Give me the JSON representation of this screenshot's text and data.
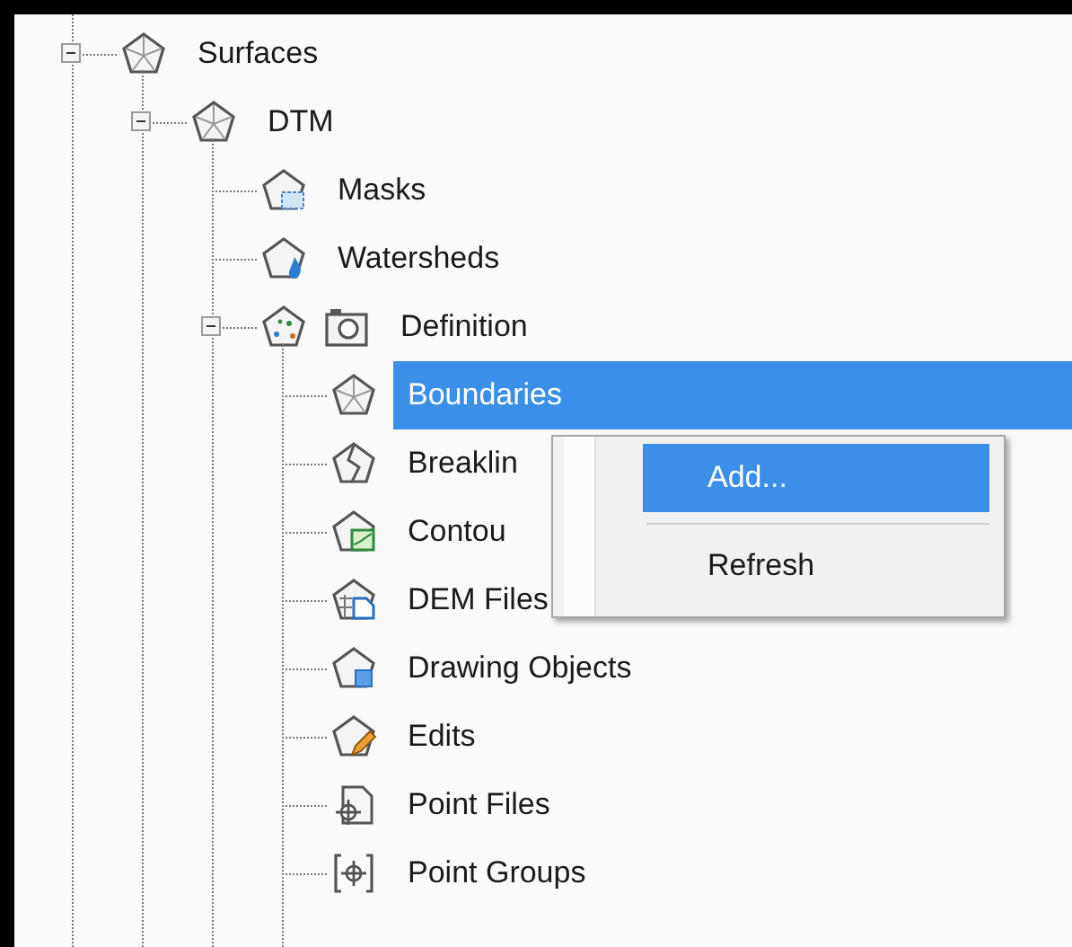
{
  "tree": [
    {
      "label": "Surfaces",
      "kind": "surface",
      "expanded": true,
      "selected": false,
      "children": [
        {
          "label": "DTM",
          "kind": "surface",
          "expanded": true,
          "selected": false,
          "children": [
            {
              "label": "Masks",
              "kind": "mask",
              "selected": false
            },
            {
              "label": "Watersheds",
              "kind": "watershed",
              "selected": false
            },
            {
              "label": "Definition",
              "kind": "definition",
              "expanded": true,
              "selected": false,
              "children": [
                {
                  "label": "Boundaries",
                  "kind": "boundary",
                  "selected": true
                },
                {
                  "label": "Breaklin",
                  "kind": "breakline",
                  "selected": false
                },
                {
                  "label": "Contou",
                  "kind": "contour",
                  "selected": false
                },
                {
                  "label": "DEM Files",
                  "kind": "dem",
                  "selected": false
                },
                {
                  "label": "Drawing Objects",
                  "kind": "drawing-object",
                  "selected": false
                },
                {
                  "label": "Edits",
                  "kind": "edit",
                  "selected": false
                },
                {
                  "label": "Point Files",
                  "kind": "point-file",
                  "selected": false
                },
                {
                  "label": "Point Groups",
                  "kind": "point-group",
                  "selected": false
                }
              ]
            }
          ]
        }
      ]
    }
  ],
  "context_menu": [
    {
      "kind": "item",
      "label": "Add...",
      "selected": true
    },
    {
      "kind": "separator"
    },
    {
      "kind": "item",
      "label": "Refresh",
      "selected": false
    }
  ]
}
